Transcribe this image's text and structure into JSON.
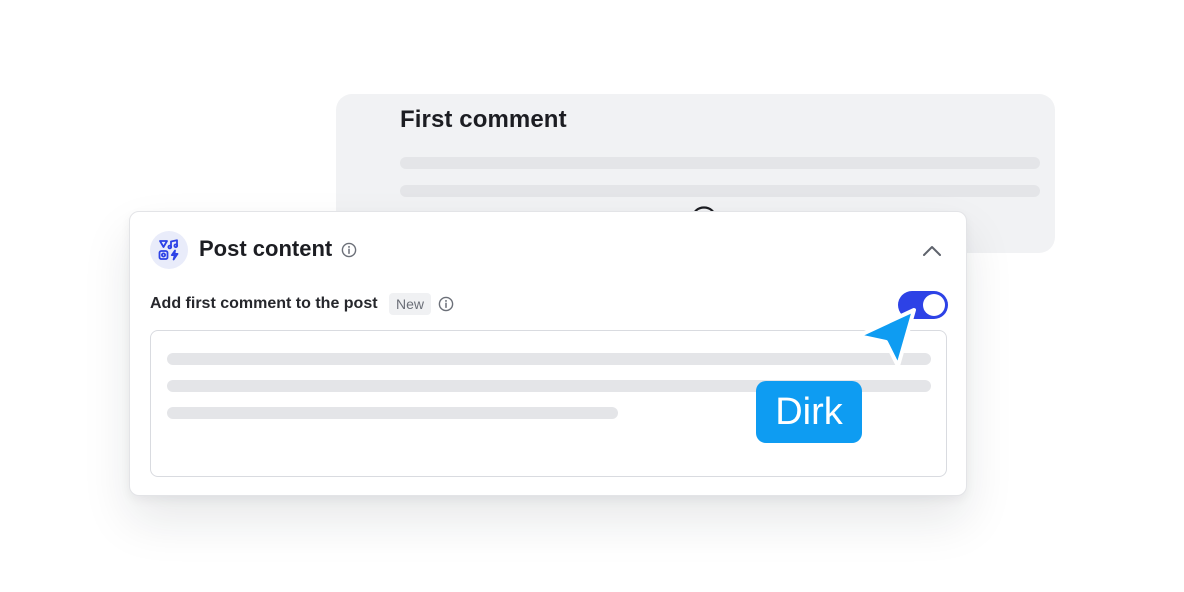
{
  "first_comment_card": {
    "title": "First comment",
    "icon": "speech-bubble-t-icon"
  },
  "post_content_card": {
    "title": "Post content",
    "icon": "media-types-icon",
    "info_icon": "info-icon",
    "collapse_icon": "chevron-up-icon",
    "field": {
      "label": "Add first comment to the post",
      "badge": "New",
      "toggle_on": true
    }
  },
  "cursor": {
    "name": "Dirk",
    "color": "#0e9cf2"
  },
  "colors": {
    "accent": "#2d42e6",
    "cursor": "#0e9cf2",
    "placeholder_bar": "#e4e5e8"
  }
}
